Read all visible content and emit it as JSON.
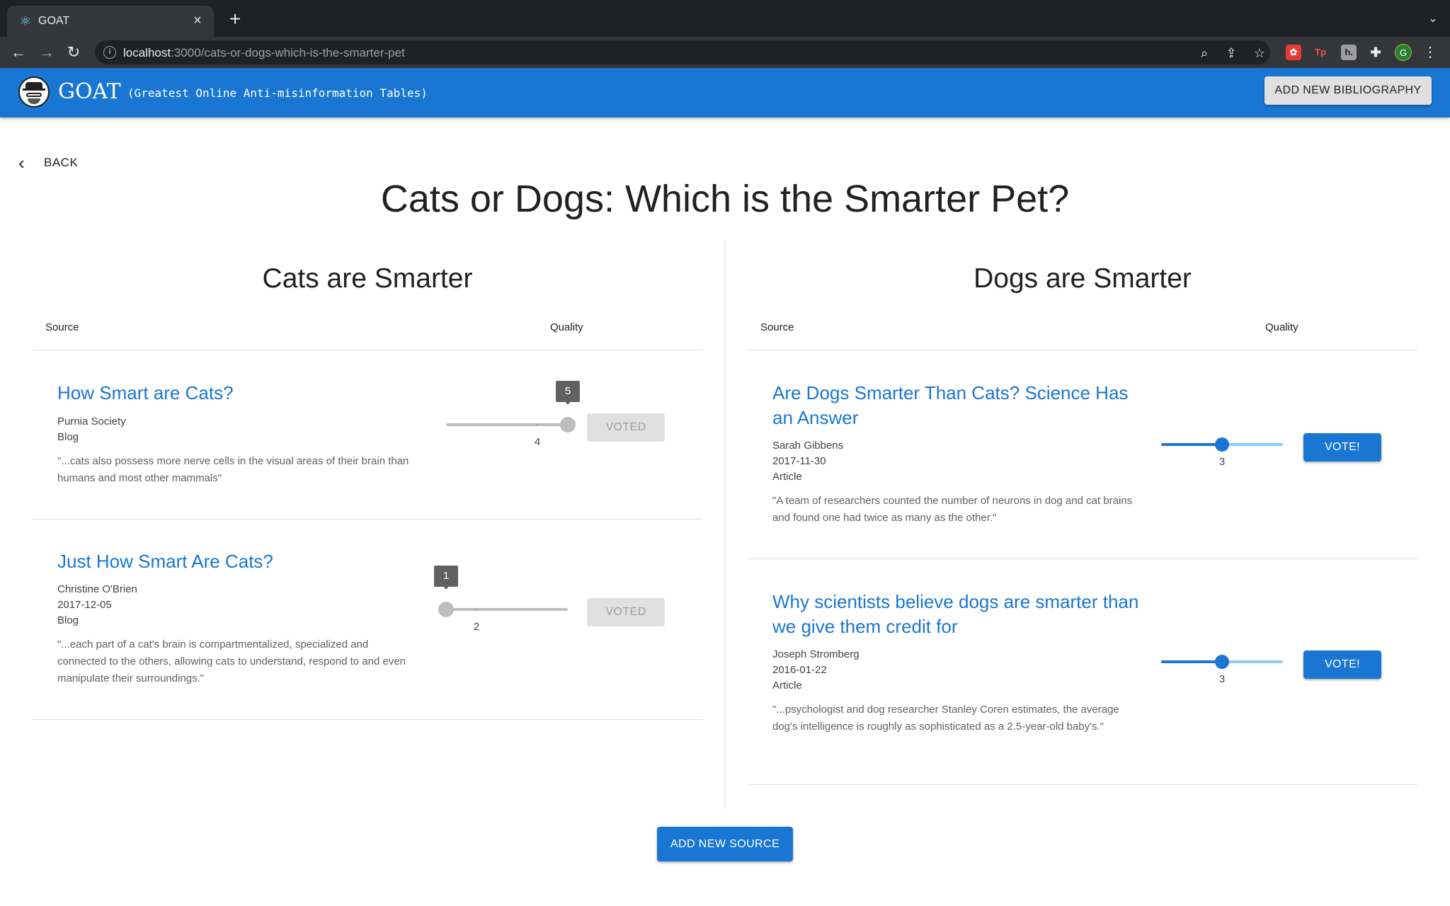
{
  "browser": {
    "tab_title": "GOAT",
    "url_host": "localhost",
    "url_path": ":3000/cats-or-dogs-which-is-the-smarter-pet",
    "profile_initial": "G"
  },
  "appbar": {
    "title": "GOAT",
    "subtitle": "(Greatest Online Anti-misinformation Tables)",
    "add_bibliography_label": "ADD NEW BIBLIOGRAPHY"
  },
  "nav": {
    "back_label": "BACK"
  },
  "page": {
    "title": "Cats or Dogs: Which is the Smarter Pet?"
  },
  "columns": [
    {
      "title": "Cats are Smarter",
      "header_source": "Source",
      "header_quality": "Quality",
      "sources": [
        {
          "title": "How Smart are Cats?",
          "meta": [
            "Purnia Society",
            "Blog"
          ],
          "quote": "\"...cats also possess more nerve cells in the visual areas of their brain than humans and most other mammals\"",
          "slider_value": 5,
          "slider_min": 1,
          "slider_max": 5,
          "slider_value_label": "5",
          "slider_mark": "4",
          "slider_mark_value": 4,
          "voted": true,
          "button_label": "VOTED"
        },
        {
          "title": "Just How Smart Are Cats?",
          "meta": [
            "Christine O'Brien",
            "2017-12-05",
            "Blog"
          ],
          "quote": "\"...each part of a cat's brain is compartmentalized, specialized and connected to the others, allowing cats to understand, respond to and even manipulate their surroundings.\"",
          "slider_value": 1,
          "slider_min": 1,
          "slider_max": 5,
          "slider_value_label": "1",
          "slider_mark": "2",
          "slider_mark_value": 2,
          "voted": true,
          "button_label": "VOTED"
        }
      ]
    },
    {
      "title": "Dogs are Smarter",
      "header_source": "Source",
      "header_quality": "Quality",
      "sources": [
        {
          "title": "Are Dogs Smarter Than Cats? Science Has an Answer",
          "meta": [
            "Sarah Gibbens",
            "2017-11-30",
            "Article"
          ],
          "quote": "\"A team of researchers counted the number of neurons in dog and cat brains and found one had twice as many as the other.\"",
          "slider_value": 3,
          "slider_min": 1,
          "slider_max": 5,
          "slider_mark": "3",
          "slider_mark_value": 3,
          "voted": false,
          "button_label": "VOTE!"
        },
        {
          "title": "Why scientists believe dogs are smarter than we give them credit for",
          "meta": [
            "Joseph Stromberg",
            "2016-01-22",
            "Article"
          ],
          "quote": "\"...psychologist and dog researcher Stanley Coren estimates, the average dog's intelligence is roughly as sophisticated as a 2.5-year-old baby's.\"",
          "slider_value": 3,
          "slider_min": 1,
          "slider_max": 5,
          "slider_mark": "3",
          "slider_mark_value": 3,
          "voted": false,
          "button_label": "VOTE!"
        }
      ]
    }
  ],
  "footer": {
    "add_source_label": "ADD NEW SOURCE"
  },
  "colors": {
    "primary": "#1976d2",
    "voted_bg": "#e0e0e0",
    "slider_inactive": "#bdbdbd"
  }
}
